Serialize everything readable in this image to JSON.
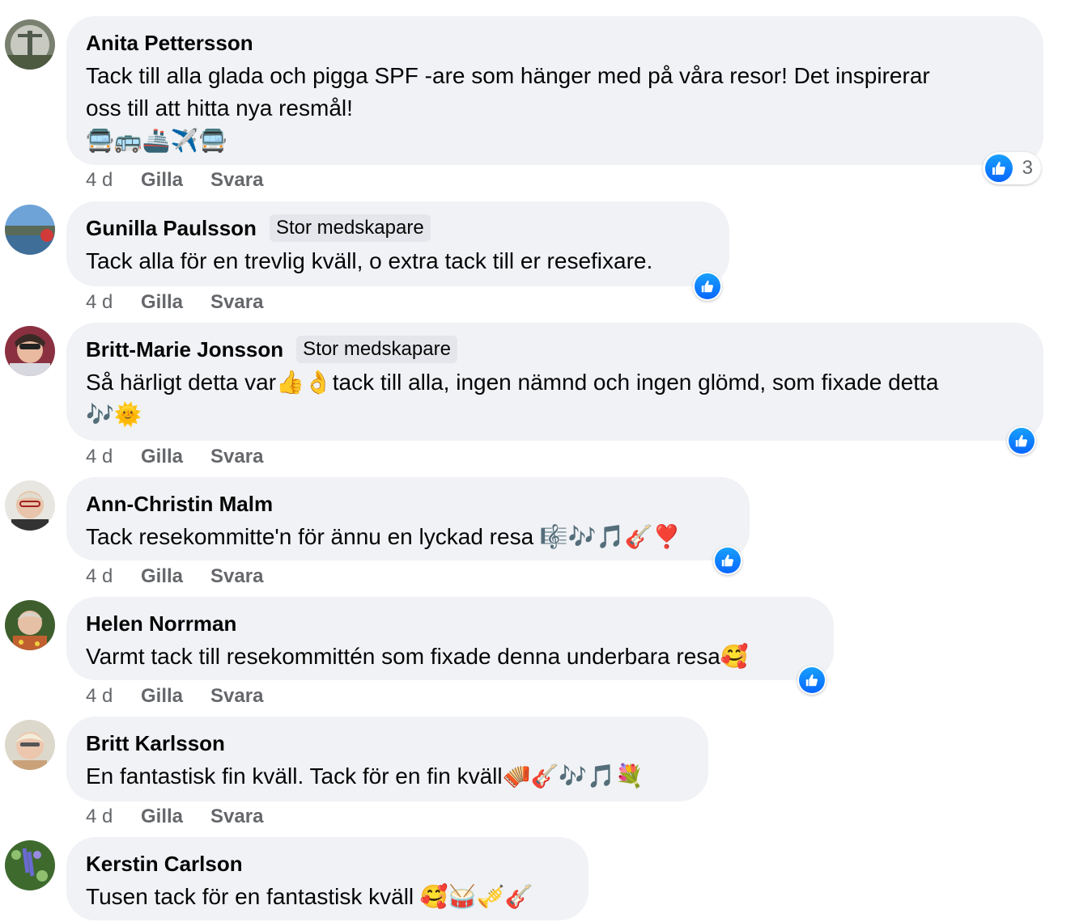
{
  "comments": [
    {
      "author": "Anita Pettersson",
      "badge": "",
      "line1": "Tack till alla glada och pigga SPF -are som hänger med på våra resor! Det inspirerar",
      "line2": "oss till att hitta nya resmål!",
      "line3": "🚍🚌🚢✈️🚍",
      "time": "4 d",
      "like_label": "Gilla",
      "reply_label": "Svara",
      "reaction_count": "3"
    },
    {
      "author": "Gunilla Paulsson",
      "badge": "Stor medskapare",
      "line1": "Tack alla för en trevlig kväll, o extra tack till er resefixare.",
      "time": "4 d",
      "like_label": "Gilla",
      "reply_label": "Svara"
    },
    {
      "author": "Britt-Marie Jonsson",
      "badge": "Stor medskapare",
      "line1": "Så härligt detta var👍👌tack till alla, ingen nämnd och ingen glömd, som fixade detta",
      "line2": "🎶🌞",
      "time": "4 d",
      "like_label": "Gilla",
      "reply_label": "Svara"
    },
    {
      "author": "Ann-Christin Malm",
      "badge": "",
      "line1": "Tack resekommitte'n för ännu en lyckad resa 🎼🎶🎵🎸❣️",
      "time": "4 d",
      "like_label": "Gilla",
      "reply_label": "Svara"
    },
    {
      "author": "Helen Norrman",
      "badge": "",
      "line1": "Varmt tack till resekommittén som fixade denna underbara resa🥰",
      "time": "4 d",
      "like_label": "Gilla",
      "reply_label": "Svara"
    },
    {
      "author": "Britt Karlsson",
      "badge": "",
      "line1": "En fantastisk fin kväll. Tack för en fin kväll🪗🎸🎶🎵💐",
      "time": "4 d",
      "like_label": "Gilla",
      "reply_label": "Svara"
    },
    {
      "author": "Kerstin Carlson",
      "badge": "",
      "line1": "Tusen tack för en fantastisk kväll 🥰🥁🎺🎸"
    }
  ],
  "colors": {
    "bubble": "#f0f2f5",
    "meta_text": "#65676b",
    "like_blue": "#0866ff"
  },
  "icons": {
    "reaction": "like-icon"
  }
}
